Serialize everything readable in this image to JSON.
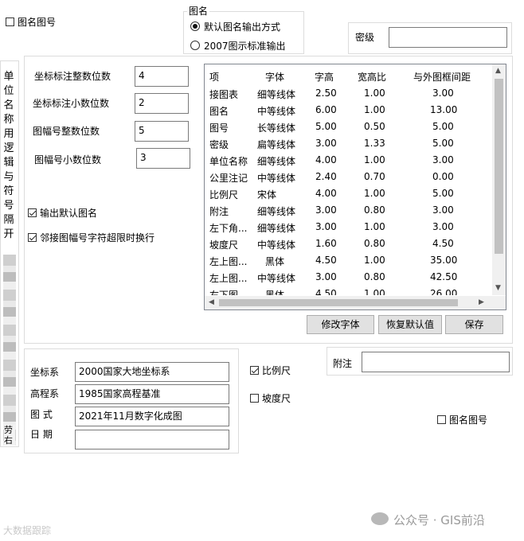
{
  "top": {
    "map_name_number_check": {
      "label": "图名图号",
      "checked": false
    },
    "map_name_group": {
      "title": "图名",
      "options": [
        {
          "label": "默认图名输出方式",
          "checked": true
        },
        {
          "label": "2007图示标准输出",
          "checked": false
        }
      ]
    },
    "secret_level": {
      "label": "密级",
      "value": ""
    }
  },
  "side_vertical_text": "单位名称用逻辑与符号隔开",
  "side_blurred_text": "劳右",
  "numbers": {
    "coord_int_digits": {
      "label": "坐标标注整数位数",
      "value": "4"
    },
    "coord_dec_digits": {
      "label": "坐标标注小数位数",
      "value": "2"
    },
    "sheet_int_digits": {
      "label": "图幅号整数位数",
      "value": "5"
    },
    "sheet_dec_digits": {
      "label": "图幅号小数位数",
      "value": "3"
    }
  },
  "options": {
    "output_default_name": {
      "label": "输出默认图名",
      "checked": true
    },
    "adjacent_wrap": {
      "label": "邻接图幅号字符超限时换行",
      "checked": true
    }
  },
  "table": {
    "columns": [
      "项",
      "字体",
      "字高",
      "宽高比",
      "与外图框间距"
    ],
    "rows": [
      [
        "接图表",
        "细等线体",
        "2.50",
        "1.00",
        "3.00"
      ],
      [
        "图名",
        "中等线体",
        "6.00",
        "1.00",
        "13.00"
      ],
      [
        "图号",
        "长等线体",
        "5.00",
        "0.50",
        "5.00"
      ],
      [
        "密级",
        "扁等线体",
        "3.00",
        "1.33",
        "5.00"
      ],
      [
        "单位名称",
        "细等线体",
        "4.00",
        "1.00",
        "3.00"
      ],
      [
        "公里注记",
        "中等线体",
        "2.40",
        "0.70",
        "0.00"
      ],
      [
        "比例尺",
        "宋体",
        "4.00",
        "1.00",
        "5.00"
      ],
      [
        "附注",
        "细等线体",
        "3.00",
        "0.80",
        "3.00"
      ],
      [
        "左下角...",
        "细等线体",
        "3.00",
        "1.00",
        "3.00"
      ],
      [
        "坡度尺",
        "中等线体",
        "1.60",
        "0.80",
        "4.50"
      ],
      [
        "左上图...",
        "黑体",
        "4.50",
        "1.00",
        "35.00"
      ],
      [
        "左上图...",
        "中等线体",
        "3.00",
        "0.80",
        "42.50"
      ],
      [
        "右下图",
        "黑体",
        "4.50",
        "1.00",
        "26.00"
      ]
    ]
  },
  "buttons": {
    "modify_font": "修改字体",
    "restore_default": "恢复默认值",
    "save": "保存"
  },
  "bottom": {
    "coord_system": {
      "label": "坐标系",
      "value": "2000国家大地坐标系"
    },
    "height_system": {
      "label": "高程系",
      "value": "1985国家高程基准"
    },
    "map_style": {
      "label": "图 式",
      "value": "2021年11月数字化成图"
    },
    "date": {
      "label": "日 期",
      "value": ""
    },
    "scale_bar": {
      "label": "比例尺",
      "checked": true
    },
    "slope_bar": {
      "label": "坡度尺",
      "checked": false
    },
    "note": {
      "label": "附注",
      "value": ""
    },
    "map_name_number_check": {
      "label": "图名图号",
      "checked": false
    }
  },
  "watermark": {
    "left": "大数据跟踪",
    "right": "公众号 · GIS前沿"
  }
}
